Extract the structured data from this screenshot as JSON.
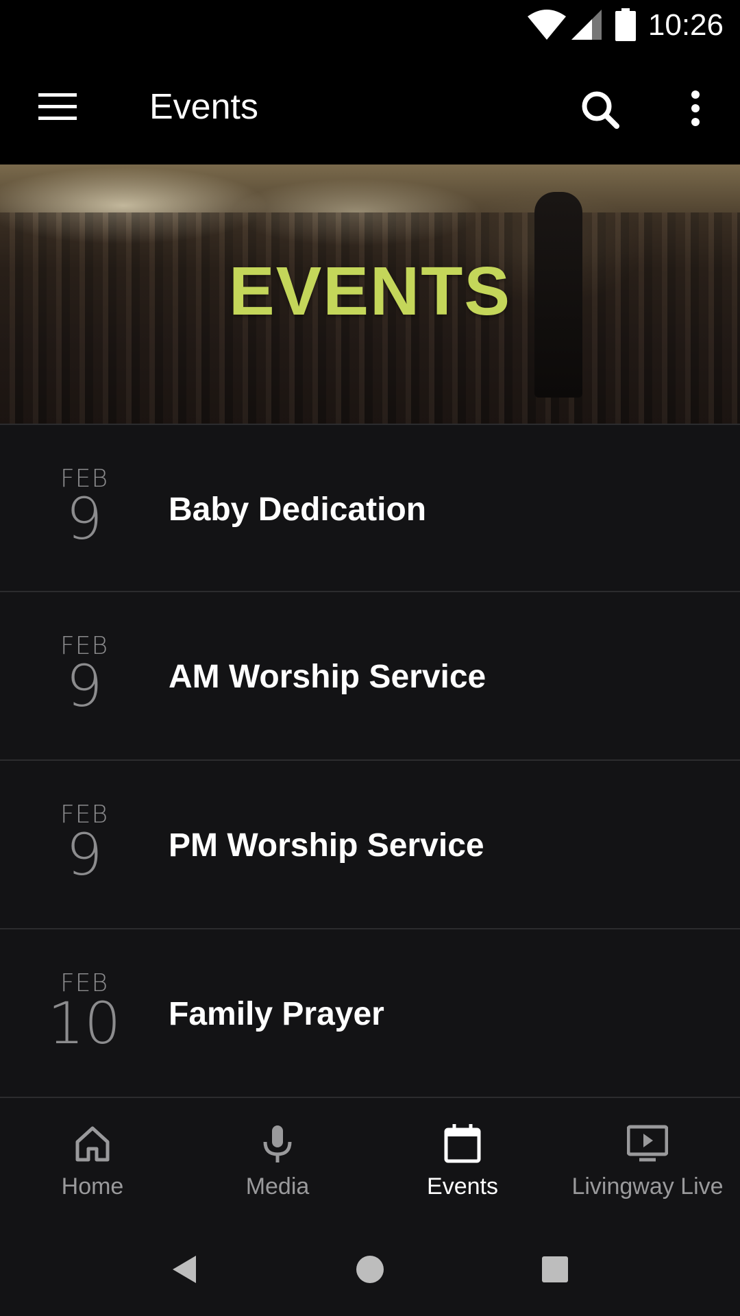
{
  "status_bar": {
    "time": "10:26",
    "icons": [
      "wifi-icon",
      "cellular-signal-icon",
      "battery-icon"
    ]
  },
  "app_bar": {
    "title": "Events",
    "icons": [
      "hamburger-menu-icon",
      "search-icon",
      "more-vert-icon"
    ]
  },
  "banner": {
    "title": "EVENTS",
    "title_color": "#c4d65a"
  },
  "events": [
    {
      "month": "FEB",
      "day": "9",
      "title": "Baby Dedication"
    },
    {
      "month": "FEB",
      "day": "9",
      "title": "AM Worship Service"
    },
    {
      "month": "FEB",
      "day": "9",
      "title": "PM Worship Service"
    },
    {
      "month": "FEB",
      "day": "10",
      "title": "Family Prayer"
    }
  ],
  "bottom_nav": {
    "items": [
      {
        "label": "Home",
        "icon": "home-icon",
        "active": false
      },
      {
        "label": "Media",
        "icon": "microphone-icon",
        "active": false
      },
      {
        "label": "Events",
        "icon": "calendar-icon",
        "active": true
      },
      {
        "label": "Livingway Live",
        "icon": "live-tv-icon",
        "active": false
      }
    ]
  },
  "system_nav": {
    "icons": [
      "back-icon",
      "home-circle-icon",
      "recents-icon"
    ]
  }
}
